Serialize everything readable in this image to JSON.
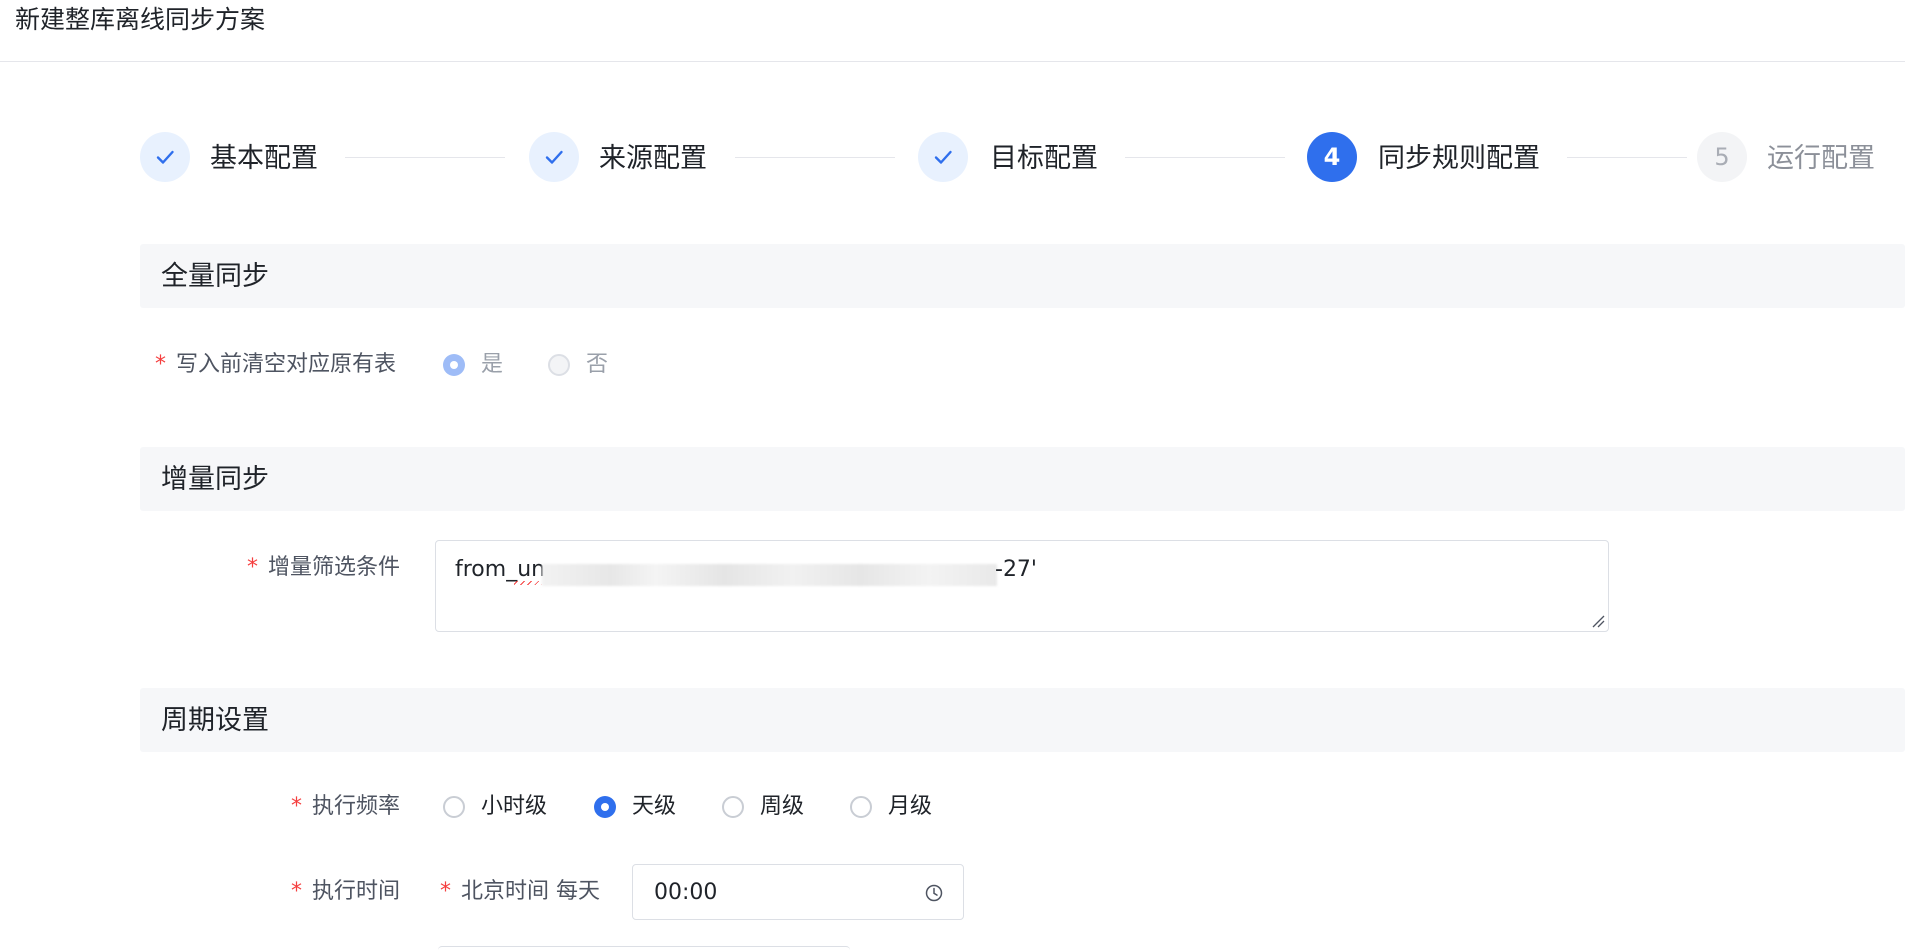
{
  "page": {
    "title": "新建整库离线同步方案"
  },
  "steps": [
    {
      "label": "基本配置",
      "status": "done",
      "icon": "check-icon"
    },
    {
      "label": "来源配置",
      "status": "done",
      "icon": "check-icon"
    },
    {
      "label": "目标配置",
      "status": "done",
      "icon": "check-icon"
    },
    {
      "number": "4",
      "label": "同步规则配置",
      "status": "active"
    },
    {
      "number": "5",
      "label": "运行配置",
      "status": "wait"
    }
  ],
  "sections": {
    "full_sync": {
      "title": "全量同步",
      "clear_table": {
        "required_mark": "*",
        "label": "写入前清空对应原有表",
        "options": [
          {
            "label": "是",
            "checked": true,
            "disabled": true
          },
          {
            "label": "否",
            "checked": false,
            "disabled": true
          }
        ]
      }
    },
    "incremental_sync": {
      "title": "增量同步",
      "filter": {
        "required_mark": "*",
        "label": "增量筛选条件",
        "value_start": "from_un",
        "value_end": "-27'"
      }
    },
    "schedule": {
      "title": "周期设置",
      "frequency": {
        "required_mark": "*",
        "label": "执行频率",
        "options": [
          {
            "label": "小时级",
            "checked": false
          },
          {
            "label": "天级",
            "checked": true
          },
          {
            "label": "周级",
            "checked": false
          },
          {
            "label": "月级",
            "checked": false
          }
        ]
      },
      "exec_time": {
        "required_mark": "*",
        "label": "执行时间",
        "sub_required_mark": "*",
        "sub_label": "北京时间 每天",
        "value": "00:00",
        "icon": "clock-icon"
      }
    }
  },
  "colors": {
    "primary": "#2f6fed",
    "required": "#f53f3f",
    "section_bg": "#f6f7f9"
  }
}
